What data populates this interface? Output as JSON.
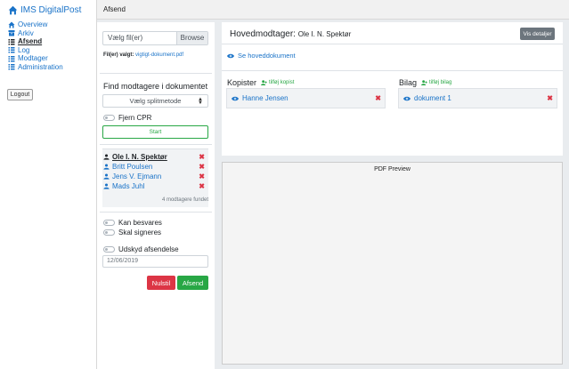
{
  "app": {
    "title": "IMS DigitalPost"
  },
  "nav": {
    "items": [
      {
        "label": "Overview",
        "icon": "home-icon",
        "active": false
      },
      {
        "label": "Arkiv",
        "icon": "archive-icon",
        "active": false
      },
      {
        "label": "Afsend",
        "icon": "list-icon",
        "active": true
      },
      {
        "label": "Log",
        "icon": "list-icon",
        "active": false
      },
      {
        "label": "Modtager",
        "icon": "list-icon",
        "active": false
      },
      {
        "label": "Administration",
        "icon": "list-icon",
        "active": false
      }
    ],
    "logout_label": "Logout"
  },
  "header": {
    "title": "Afsend"
  },
  "file": {
    "placeholder": "Vælg fil(er)",
    "browse_label": "Browse",
    "chosen_label": "Fil(er) valgt:",
    "chosen_value": "vigtigt-dokument.pdf"
  },
  "find": {
    "heading": "Find modtagere i dokumentet",
    "split_method": "Vælg splitmetode",
    "remove_cpr_label": "Fjern CPR",
    "start_label": "Start"
  },
  "recipients": {
    "items": [
      {
        "name": "Ole I. N. Spektør",
        "selected": true
      },
      {
        "name": "Britt Poulsen",
        "selected": false
      },
      {
        "name": "Jens V. Ejmann",
        "selected": false
      },
      {
        "name": "Mads Juhl",
        "selected": false
      }
    ],
    "count_text": "4 modtagere fundet"
  },
  "options": {
    "can_reply_label": "Kan besvares",
    "must_sign_label": "Skal signeres",
    "delay_label": "Udskyd afsendelse",
    "date_value": "12/06/2019"
  },
  "actions": {
    "reset_label": "Nulstil",
    "send_label": "Afsend"
  },
  "main_recipient": {
    "heading": "Hovedmodtager:",
    "name": "Ole I. N. Spektør",
    "details_label": "Vis detaljer",
    "view_document_label": "Se hoveddokument"
  },
  "copies": {
    "heading": "Kopister",
    "add_label": "tilføj kopist",
    "items": [
      "Hanne Jensen"
    ]
  },
  "attachments": {
    "heading": "Bilag",
    "add_label": "tilføj bilag",
    "items": [
      "dokument 1"
    ]
  },
  "preview": {
    "title": "PDF Preview"
  },
  "colors": {
    "link": "#1a73c8",
    "success": "#28a745",
    "danger": "#dc3545",
    "secondary": "#6c757d"
  }
}
